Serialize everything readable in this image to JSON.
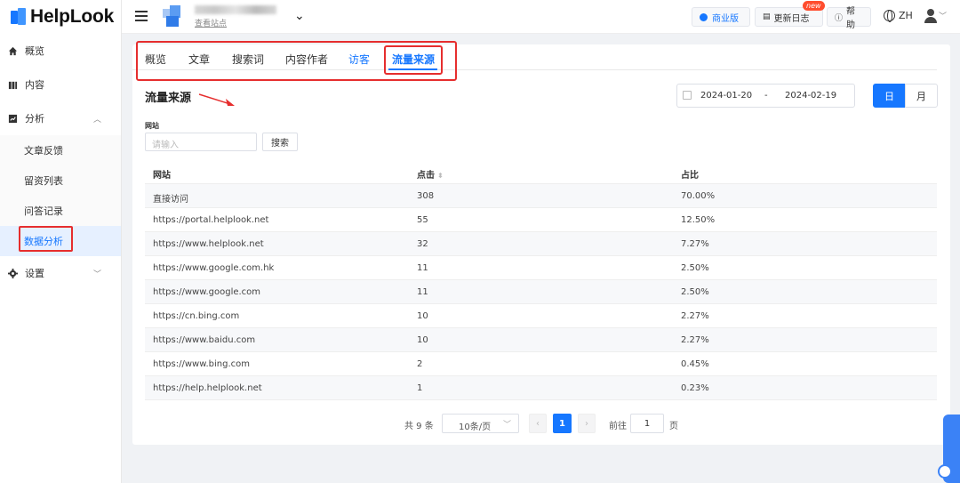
{
  "brand": {
    "name": "HelpLook"
  },
  "sidebar": {
    "items": [
      {
        "label": "概览",
        "icon": "home-icon"
      },
      {
        "label": "内容",
        "icon": "book-icon"
      },
      {
        "label": "分析",
        "icon": "chart-icon"
      },
      {
        "label": "设置",
        "icon": "gear-icon"
      }
    ],
    "sub_items": [
      {
        "label": "文章反馈"
      },
      {
        "label": "留资列表"
      },
      {
        "label": "问答记录"
      },
      {
        "label": "数据分析",
        "active": true
      }
    ]
  },
  "header": {
    "site_link": "查看站点",
    "buttons": {
      "business": "商业版",
      "changelog": "更新日志",
      "help": "帮助"
    },
    "new_badge": "new",
    "lang": "ZH"
  },
  "tabs": [
    {
      "label": "概览"
    },
    {
      "label": "文章"
    },
    {
      "label": "搜索词"
    },
    {
      "label": "内容作者"
    },
    {
      "label": "访客"
    },
    {
      "label": "流量来源",
      "active": true
    }
  ],
  "section": {
    "title": "流量来源"
  },
  "date_range": {
    "start": "2024-01-20",
    "separator": "-",
    "end": "2024-02-19"
  },
  "granularity": {
    "day": "日",
    "month": "月",
    "selected": "日"
  },
  "filter": {
    "label": "网站",
    "placeholder": "请输入",
    "button": "搜索"
  },
  "table": {
    "columns": [
      "网站",
      "点击",
      "占比"
    ],
    "rows": [
      [
        "直接访问",
        "308",
        "70.00%"
      ],
      [
        "https://portal.helplook.net",
        "55",
        "12.50%"
      ],
      [
        "https://www.helplook.net",
        "32",
        "7.27%"
      ],
      [
        "https://www.google.com.hk",
        "11",
        "2.50%"
      ],
      [
        "https://www.google.com",
        "11",
        "2.50%"
      ],
      [
        "https://cn.bing.com",
        "10",
        "2.27%"
      ],
      [
        "https://www.baidu.com",
        "10",
        "2.27%"
      ],
      [
        "https://www.bing.com",
        "2",
        "0.45%"
      ],
      [
        "https://help.helplook.net",
        "1",
        "0.23%"
      ]
    ]
  },
  "pagination": {
    "total": "共 9 条",
    "page_size": "10条/页",
    "current": "1",
    "goto_label": "前往",
    "goto_value": "1",
    "goto_unit": "页"
  },
  "colors": {
    "accent": "#1677ff",
    "annotation": "#e62e2e"
  }
}
